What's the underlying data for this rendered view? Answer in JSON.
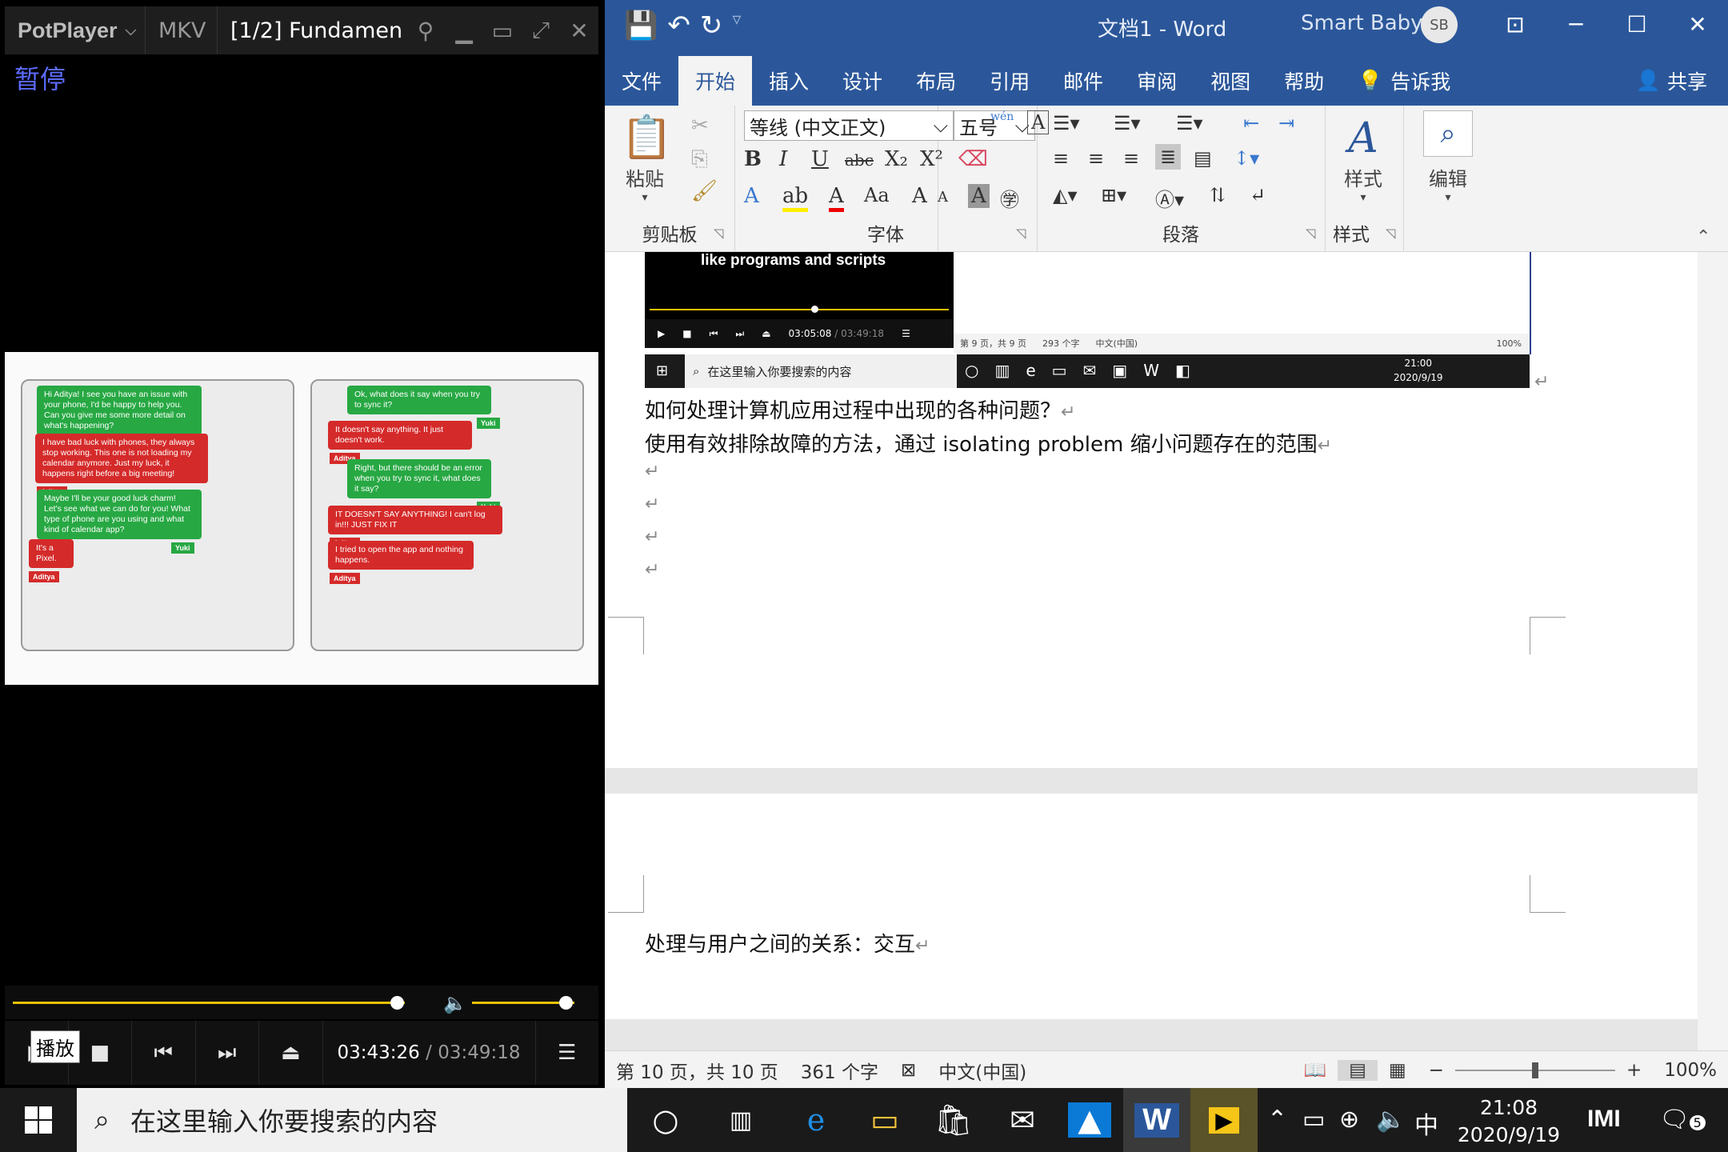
{
  "potplayer": {
    "brand": "PotPlayer",
    "format": "MKV",
    "file_title": "[1/2] Fundamen",
    "state_label": "暂停",
    "time_current": "03:43:26",
    "time_separator": "/",
    "time_total": "03:49:18",
    "seek_progress": 0.98,
    "volume_level": 0.85,
    "tooltip": "播放",
    "chat_left": [
      {
        "text": "Hi Aditya! I see you have an issue with your phone, I'd be happy to help you. Can you give me some more detail on what's happening?",
        "who": "Yuki",
        "color": "g"
      },
      {
        "text": "I have bad luck with phones, they always stop working. This one is not loading my calendar anymore. Just my luck, it happens right before a big meeting!",
        "who": "Aditya",
        "color": "r"
      },
      {
        "text": "Maybe I'll be your good luck charm! Let's see what we can do for you! What type of phone are you using and what kind of calendar app?",
        "who": "Yuki",
        "color": "g"
      },
      {
        "text": "It's a Pixel.",
        "who": "Aditya",
        "color": "r"
      }
    ],
    "chat_right": [
      {
        "text": "Ok, what does it say when you try to sync it?",
        "who": "Yuki",
        "color": "g"
      },
      {
        "text": "It doesn't say anything. It just doesn't work.",
        "who": "Aditya",
        "color": "r"
      },
      {
        "text": "Right, but there should be an error when you try to sync it, what does it say?",
        "who": "Yuki",
        "color": "g"
      },
      {
        "text": "IT DOESN'T SAY ANYTHING! I can't log in!!! JUST FIX IT",
        "who": "Aditya",
        "color": "r"
      },
      {
        "text": "I tried to open the app and nothing happens.",
        "who": "Aditya",
        "color": "r"
      }
    ]
  },
  "word": {
    "title": "文档1  -  Word",
    "user_name": "Smart Baby",
    "user_initials": "SB",
    "tabs": [
      "文件",
      "开始",
      "插入",
      "设计",
      "布局",
      "引用",
      "邮件",
      "审阅",
      "视图",
      "帮助"
    ],
    "active_tab": "开始",
    "tell_me": "告诉我",
    "share": "共享",
    "ribbon": {
      "paste": "粘贴",
      "clipboard": "剪贴板",
      "font_name": "等线 (中文正文)",
      "font_size": "五号",
      "font_group": "字体",
      "paragraph_group": "段落",
      "styles_button": "样式",
      "styles_group": "样式",
      "edit_button": "编辑",
      "bold": "B",
      "italic": "I",
      "underline": "U",
      "strike": "abc",
      "subscript": "X₂",
      "superscript": "X²",
      "change_case": "Aa",
      "grow": "A",
      "shrink": "A",
      "wen": "wén"
    },
    "embedded_screenshot": {
      "caption": "like programs and scripts",
      "time_current": "03:05:08",
      "time_total": "03:49:18",
      "status_page": "第 9 页，共 9 页",
      "status_words": "293 个字",
      "status_lang": "中文(中国)",
      "zoom": "100%",
      "search_placeholder": "在这里输入你要搜索的内容",
      "clock_time": "21:00",
      "clock_date": "2020/9/19"
    },
    "doc_lines": [
      "如何处理计算机应用过程中出现的各种问题？",
      "使用有效排除故障的方法，通过 isolating problem 缩小问题存在的范围"
    ],
    "page2_line": "处理与用户之间的关系：交互",
    "paragraph_mark": "↵",
    "status": {
      "page": "第 10 页，共 10 页",
      "words": "361 个字",
      "language": "中文(中国)",
      "zoom": "100%"
    }
  },
  "taskbar": {
    "search_placeholder": "在这里输入你要搜索的内容",
    "ime": "中",
    "clock_time": "21:08",
    "clock_date": "2020/9/19",
    "notification_count": "5"
  }
}
